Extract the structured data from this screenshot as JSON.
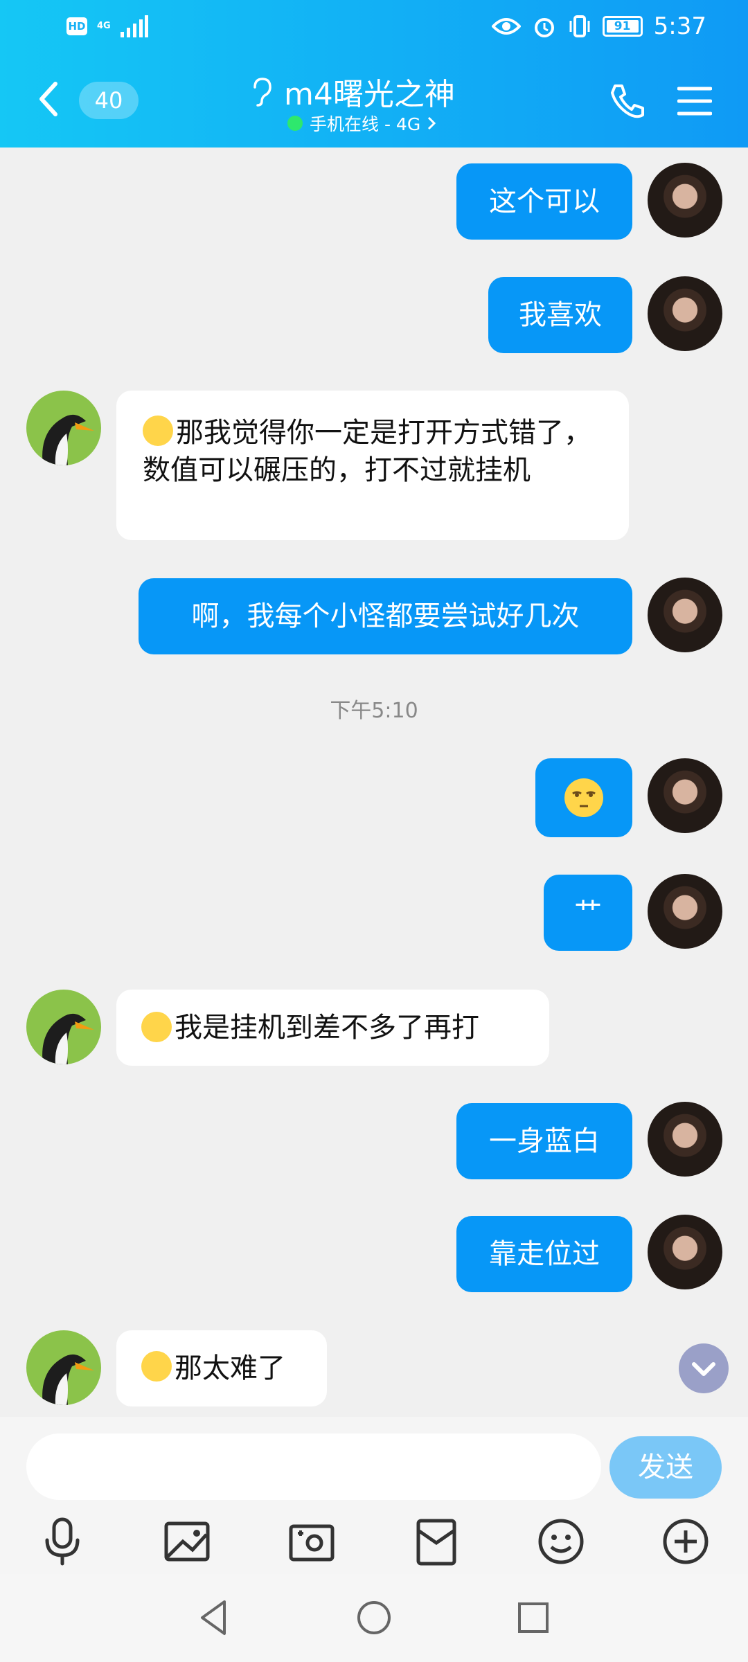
{
  "status": {
    "hd": "HD",
    "network": "4G",
    "battery": "91",
    "time": "5:37"
  },
  "header": {
    "unread_count": "40",
    "title": "m4曙光之神",
    "subtitle": "手机在线 - 4G"
  },
  "messages": [
    {
      "side": "out",
      "text": "这个可以"
    },
    {
      "side": "out",
      "text": "我喜欢"
    },
    {
      "side": "in",
      "text": "那我觉得你一定是打开方式错了，数值可以碾压的，打不过就挂机"
    },
    {
      "side": "out",
      "text": "啊，我每个小怪都要尝试好几次"
    },
    {
      "side": "time",
      "text": "下午5:10"
    },
    {
      "side": "out",
      "emoji": "unamused-emoji"
    },
    {
      "side": "out",
      "text": "艹"
    },
    {
      "side": "in",
      "text": "我是挂机到差不多了再打"
    },
    {
      "side": "out",
      "text": "一身蓝白"
    },
    {
      "side": "out",
      "text": "靠走位过"
    },
    {
      "side": "in",
      "text": "那太难了"
    }
  ],
  "composer": {
    "send_label": "发送"
  },
  "toolbar_icons": [
    "microphone-icon",
    "image-icon",
    "camera-icon",
    "red-packet-icon",
    "emoji-icon",
    "plus-icon"
  ],
  "colors": {
    "header_start": "#15c7f5",
    "header_end": "#0f9af5",
    "outgoing_bubble": "#0797f7",
    "incoming_bubble": "#ffffff",
    "send_button": "#7ac7f7"
  }
}
